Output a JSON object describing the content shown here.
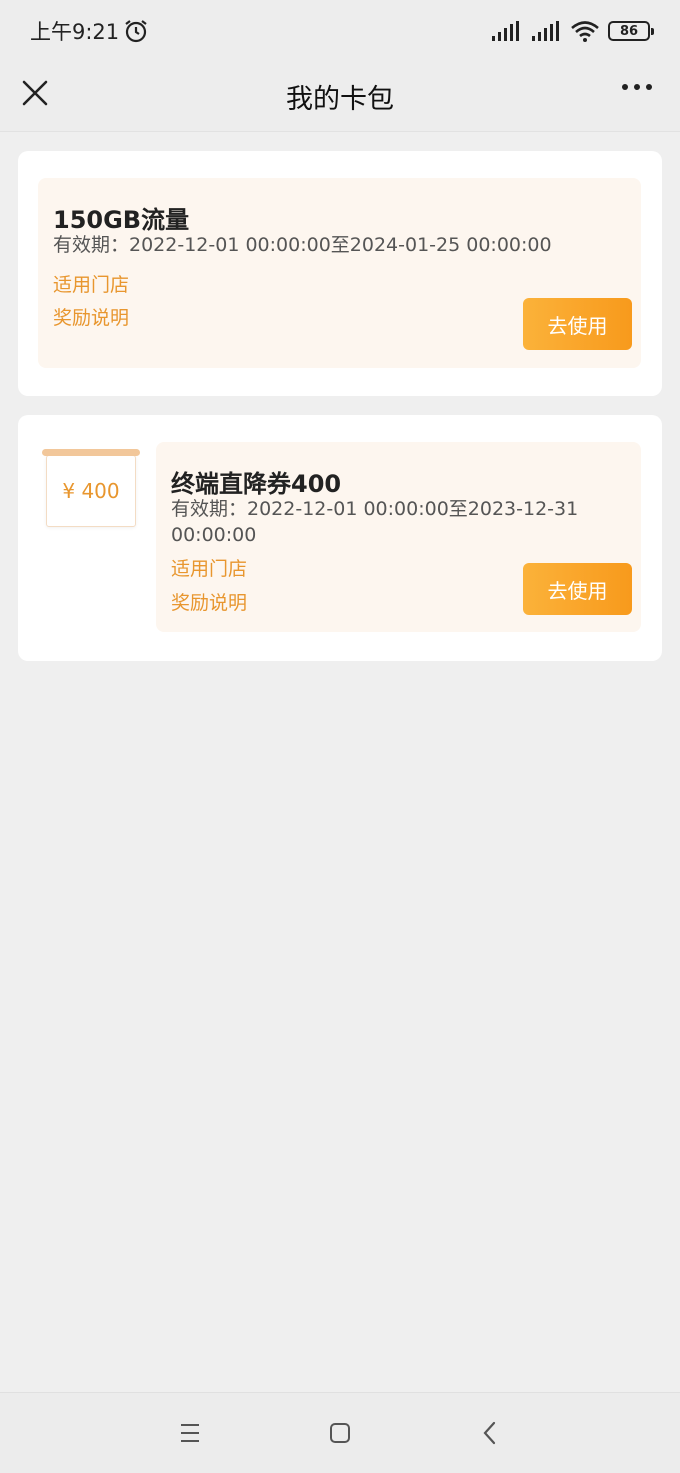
{
  "status": {
    "time": "上午9:21",
    "battery": "86"
  },
  "nav": {
    "title": "我的卡包"
  },
  "coupons": [
    {
      "title": "150GB流量",
      "validity": "有效期：2022-12-01 00:00:00至2024-01-25 00:00:00",
      "store_link": "适用门店",
      "reward_link": "奖励说明",
      "button": "去使用"
    },
    {
      "title": "终端直降券400",
      "validity": "有效期：2022-12-01 00:00:00至2023-12-31 00:00:00",
      "store_link": "适用门店",
      "reward_link": "奖励说明",
      "button": "去使用",
      "thumb_amount": "¥ 400"
    }
  ],
  "colors": {
    "accent": "#e8962e",
    "button": "#f89a1c",
    "coupon_bg": "#fdf6ef"
  }
}
